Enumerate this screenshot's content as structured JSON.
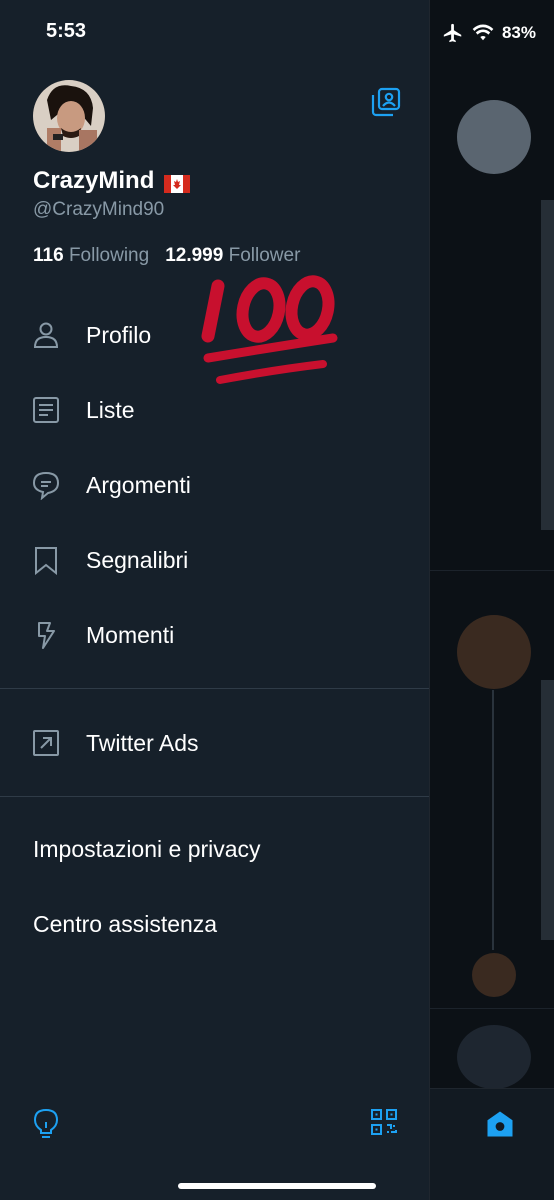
{
  "status_bar": {
    "time": "5:53",
    "battery": "83%"
  },
  "profile": {
    "display_name": "CrazyMind",
    "handle": "@CrazyMind90",
    "following_count": "116",
    "following_label": "Following",
    "follower_count": "12.999",
    "follower_label": "Follower"
  },
  "menu": {
    "items": [
      {
        "label": "Profilo",
        "icon": "person-icon"
      },
      {
        "label": "Liste",
        "icon": "list-icon"
      },
      {
        "label": "Argomenti",
        "icon": "topics-icon"
      },
      {
        "label": "Segnalibri",
        "icon": "bookmark-icon"
      },
      {
        "label": "Momenti",
        "icon": "lightning-icon"
      }
    ],
    "ads": {
      "label": "Twitter Ads",
      "icon": "external-arrow-icon"
    },
    "settings_label": "Impostazioni e privacy",
    "help_label": "Centro assistenza"
  },
  "colors": {
    "drawer_bg": "#16202a",
    "accent": "#1da1f2",
    "secondary_text": "#8899a6",
    "emoji_red": "#c8102e"
  }
}
